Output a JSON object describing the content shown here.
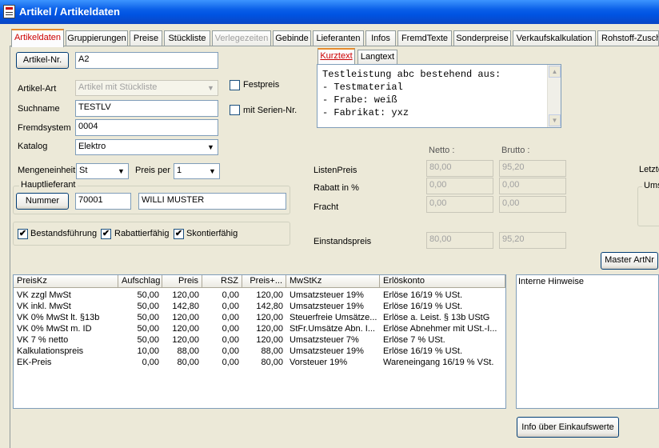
{
  "window": {
    "title": "Artikel / Artikeldaten"
  },
  "tabs": [
    "Artikeldaten",
    "Gruppierungen",
    "Preise",
    "Stückliste",
    "Verlegezeiten",
    "Gebinde",
    "Lieferanten",
    "Infos",
    "FremdTexte",
    "Sonderpreise",
    "Verkaufskalkulation",
    "Rohstoff-Zuschl"
  ],
  "form": {
    "artikel_nr_button": "Artikel-Nr.",
    "artikel_nr_value": "A2",
    "artikel_art_label": "Artikel-Art",
    "artikel_art_value": "Artikel mit Stückliste",
    "suchname_label": "Suchname",
    "suchname_value": "TESTLV",
    "fremdsystem_label": "Fremdsystem",
    "fremdsystem_value": "0004",
    "katalog_label": "Katalog",
    "katalog_value": "Elektro",
    "mengeneinheit_label": "Mengeneinheit",
    "mengeneinheit_value": "St",
    "preis_per_label": "Preis per",
    "preis_per_value": "1",
    "festpreis_label": "Festpreis",
    "serien_label": "mit Serien-Nr.",
    "hauptlieferant_legend": "Hauptlieferant",
    "nummer_button": "Nummer",
    "lieferant_nr": "70001",
    "lieferant_name": "WILLI MUSTER",
    "bestandsfuehrung_label": "Bestandsführung",
    "rabattfaehig_label": "Rabattierfähig",
    "skontofaehig_label": "Skontierfähig",
    "check": "✔"
  },
  "text_tabs": {
    "kurztext": "Kurztext",
    "langtext": "Langtext"
  },
  "kurztext": "Testleistung abc bestehend aus:\n- Testmaterial\n- Frabe: weiß\n- Fabrikat: yxz",
  "prices": {
    "netto_header": "Netto :",
    "brutto_header": "Brutto :",
    "listenpreis_label": "ListenPreis",
    "listenpreis_netto": "80,00",
    "listenpreis_brutto": "95,20",
    "rabatt_label": "Rabatt in %",
    "rabatt_netto": "0,00",
    "rabatt_brutto": "0,00",
    "fracht_label": "Fracht",
    "fracht_netto": "0,00",
    "fracht_brutto": "0,00",
    "einstandspreis_label": "Einstandspreis",
    "einstandspreis_netto": "80,00",
    "einstandspreis_brutto": "95,20",
    "letzte_label": "Letzte",
    "ums_label": "Ums"
  },
  "master_button": "Master ArtNr",
  "grid": {
    "headers": [
      "PreisKz",
      "Aufschlag",
      "Preis",
      "RSZ",
      "Preis+...",
      "MwStKz",
      "Erlöskonto"
    ],
    "rows": [
      [
        "VK zzgl MwSt",
        "50,00",
        "120,00",
        "0,00",
        "120,00",
        "Umsatzsteuer 19%",
        "Erlöse 16/19 % USt."
      ],
      [
        "VK inkl. MwSt",
        "50,00",
        "142,80",
        "0,00",
        "142,80",
        "Umsatzsteuer 19%",
        "Erlöse 16/19 % USt."
      ],
      [
        "VK 0% MwSt lt. §13b",
        "50,00",
        "120,00",
        "0,00",
        "120,00",
        "Steuerfreie Umsätze...",
        "Erlöse a. Leist. § 13b UStG"
      ],
      [
        "VK 0% MwSt m. ID",
        "50,00",
        "120,00",
        "0,00",
        "120,00",
        "StFr.Umsätze Abn. I...",
        "Erlöse Abnehmer mit USt.-I..."
      ],
      [
        "VK 7 % netto",
        "50,00",
        "120,00",
        "0,00",
        "120,00",
        "Umsatzsteuer 7%",
        "Erlöse  7 % USt."
      ],
      [
        "Kalkulationspreis",
        "10,00",
        "88,00",
        "0,00",
        "88,00",
        "Umsatzsteuer 19%",
        "Erlöse 16/19 % USt."
      ],
      [
        "EK-Preis",
        "0,00",
        "80,00",
        "0,00",
        "80,00",
        "Vorsteuer 19%",
        "Wareneingang 16/19 % VSt."
      ]
    ]
  },
  "interne_hinweise": "Interne Hinweise",
  "info_button": "Info über Einkaufswerte"
}
